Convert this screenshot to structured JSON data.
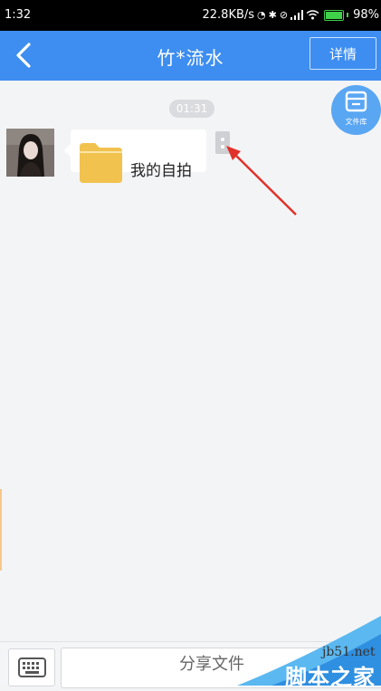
{
  "status_bar": {
    "time": "1:32",
    "speed": "22.8KB/s",
    "battery": "98%"
  },
  "header": {
    "title": "竹*流水",
    "detail_label": "详情"
  },
  "chat": {
    "timestamp": "01:31",
    "file_library_label": "文件库",
    "message": {
      "folder_name": "我的自拍"
    }
  },
  "bottom_bar": {
    "share_label": "分享文件"
  },
  "watermark": {
    "site": "jb51.net",
    "text": "脚本之家"
  },
  "colors": {
    "header": "#3d8ef0",
    "folder": "#f2c24f",
    "arrow": "#e0322b"
  }
}
